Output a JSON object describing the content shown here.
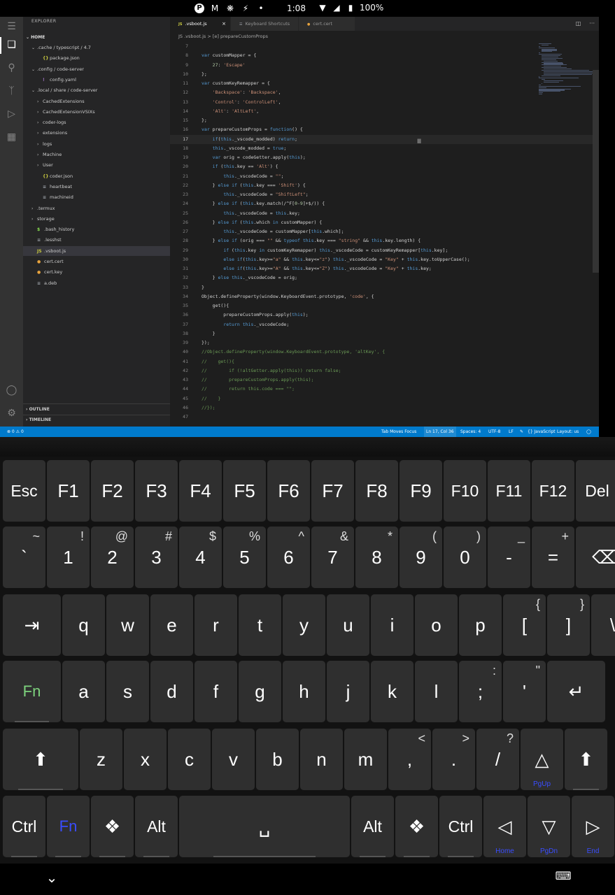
{
  "status_bar": {
    "time": "1:08",
    "battery_text": "100%"
  },
  "vscode": {
    "sidebar": {
      "title": "EXPLORER",
      "section": "HOME",
      "items": [
        {
          "label": ".cache / typescript / 4.7",
          "indent": 1,
          "chev": "⌄",
          "icon": ""
        },
        {
          "label": "package.json",
          "indent": 2,
          "chev": "",
          "icon": "{}"
        },
        {
          "label": ".config / code-server",
          "indent": 1,
          "chev": "⌄",
          "icon": ""
        },
        {
          "label": "config.yaml",
          "indent": 2,
          "chev": "",
          "icon": "!"
        },
        {
          "label": ".local / share / code-server",
          "indent": 1,
          "chev": "⌄",
          "icon": ""
        },
        {
          "label": "CachedExtensions",
          "indent": 2,
          "chev": "›",
          "icon": ""
        },
        {
          "label": "CachedExtensionVSIXs",
          "indent": 2,
          "chev": "›",
          "icon": ""
        },
        {
          "label": "coder-logs",
          "indent": 2,
          "chev": "›",
          "icon": ""
        },
        {
          "label": "extensions",
          "indent": 2,
          "chev": "›",
          "icon": ""
        },
        {
          "label": "logs",
          "indent": 2,
          "chev": "›",
          "icon": ""
        },
        {
          "label": "Machine",
          "indent": 2,
          "chev": "›",
          "icon": ""
        },
        {
          "label": "User",
          "indent": 2,
          "chev": "›",
          "icon": ""
        },
        {
          "label": "coder.json",
          "indent": 2,
          "chev": "",
          "icon": "{}"
        },
        {
          "label": "heartbeat",
          "indent": 2,
          "chev": "",
          "icon": "≡"
        },
        {
          "label": "machineid",
          "indent": 2,
          "chev": "",
          "icon": "≡"
        },
        {
          "label": ".termux",
          "indent": 1,
          "chev": "›",
          "icon": ""
        },
        {
          "label": "storage",
          "indent": 1,
          "chev": "›",
          "icon": ""
        },
        {
          "label": ".bash_history",
          "indent": 1,
          "chev": "",
          "icon": "$"
        },
        {
          "label": ".lesshst",
          "indent": 1,
          "chev": "",
          "icon": "≡"
        },
        {
          "label": ".vsboot.js",
          "indent": 1,
          "chev": "",
          "icon": "JS"
        },
        {
          "label": "cert.cert",
          "indent": 1,
          "chev": "",
          "icon": "●"
        },
        {
          "label": "cert.key",
          "indent": 1,
          "chev": "",
          "icon": "●"
        },
        {
          "label": "a.deb",
          "indent": 1,
          "chev": "",
          "icon": "≡"
        }
      ],
      "outline": "OUTLINE",
      "timeline": "TIMELINE"
    },
    "tabs": [
      {
        "label": ".vsboot.js",
        "icon": "JS",
        "close": "×"
      },
      {
        "label": "Keyboard Shortcuts",
        "icon": "☰",
        "close": ""
      },
      {
        "label": "cert.cert",
        "icon": "●",
        "close": ""
      }
    ],
    "breadcrumbs": "JS  .vsboot.js  >  [e] prepareCustomProps",
    "code": [
      {
        "n": "7",
        "t": ""
      },
      {
        "n": "8",
        "t": "var customMapper = {"
      },
      {
        "n": "9",
        "t": "    27: 'Escape'"
      },
      {
        "n": "10",
        "t": "};"
      },
      {
        "n": "11",
        "t": "var customKeyRemapper = {"
      },
      {
        "n": "12",
        "t": "    'Backspace': 'Backspace',"
      },
      {
        "n": "13",
        "t": "    'Control': 'ControlLeft',"
      },
      {
        "n": "14",
        "t": "    'Alt': 'AltLeft',"
      },
      {
        "n": "15",
        "t": "};"
      },
      {
        "n": "16",
        "t": "var prepareCustomProps = function() {"
      },
      {
        "n": "17",
        "t": "    if(this._vscode_modded) return;"
      },
      {
        "n": "18",
        "t": "    this._vscode_modded = true;"
      },
      {
        "n": "19",
        "t": "    var orig = codeGetter.apply(this);"
      },
      {
        "n": "20",
        "t": "    if (this.key == 'Alt') {"
      },
      {
        "n": "21",
        "t": "        this._vscodeCode = \"\";"
      },
      {
        "n": "22",
        "t": "    } else if (this.key === 'Shift') {"
      },
      {
        "n": "23",
        "t": "        this._vscodeCode = \"ShiftLeft\";"
      },
      {
        "n": "24",
        "t": "    } else if (this.key.match(/^F[0-9]+$/)) {"
      },
      {
        "n": "25",
        "t": "        this._vscodeCode = this.key;"
      },
      {
        "n": "26",
        "t": "    } else if (this.which in customMapper) {"
      },
      {
        "n": "27",
        "t": "        this._vscodeCode = customMapper[this.which];"
      },
      {
        "n": "28",
        "t": "    } else if (orig === \"\" && typeof this.key === \"string\" && this.key.length) {"
      },
      {
        "n": "29",
        "t": "        if (this.key in customKeyRemapper) this._vscodeCode = customKeyRemapper[this.key];"
      },
      {
        "n": "30",
        "t": "        else if(this.key>=\"a\" && this.key<=\"z\") this._vscodeCode = \"Key\" + this.key.toUpperCase();"
      },
      {
        "n": "31",
        "t": "        else if(this.key>=\"A\" && this.key<=\"Z\") this._vscodeCode = \"Key\" + this.key;"
      },
      {
        "n": "32",
        "t": "    } else this._vscodeCode = orig;"
      },
      {
        "n": "33",
        "t": "}"
      },
      {
        "n": "34",
        "t": "Object.defineProperty(window.KeyboardEvent.prototype, 'code', {"
      },
      {
        "n": "35",
        "t": "    get(){"
      },
      {
        "n": "36",
        "t": "        prepareCustomProps.apply(this);"
      },
      {
        "n": "37",
        "t": "        return this._vscodeCode;"
      },
      {
        "n": "38",
        "t": "    }"
      },
      {
        "n": "39",
        "t": "});"
      },
      {
        "n": "40",
        "t": "//Object.defineProperty(window.KeyboardEvent.prototype, 'altKey', {"
      },
      {
        "n": "41",
        "t": "//    get(){"
      },
      {
        "n": "42",
        "t": "//        if (!altGetter.apply(this)) return false;"
      },
      {
        "n": "43",
        "t": "//        prepareCustomProps.apply(this);"
      },
      {
        "n": "44",
        "t": "//        return this.code === \"\";"
      },
      {
        "n": "45",
        "t": "//    }"
      },
      {
        "n": "46",
        "t": "//});"
      },
      {
        "n": "47",
        "t": ""
      }
    ],
    "statusbar": {
      "left": "⊗ 0  ⚠ 0",
      "tab_moves_focus": "Tab Moves Focus",
      "position": "Ln 17, Col 36",
      "spaces": "Spaces: 4",
      "encoding": "UTF-8",
      "eol": "LF",
      "language": "{} JavaScript",
      "layout": "Layout: us",
      "bell": "⌂"
    }
  },
  "keyboard": {
    "rows": [
      [
        {
          "main": "Esc",
          "w": 1
        },
        {
          "main": "F1",
          "w": 1
        },
        {
          "main": "F2",
          "w": 1
        },
        {
          "main": "F3",
          "w": 1
        },
        {
          "main": "F4",
          "w": 1
        },
        {
          "main": "F5",
          "w": 1
        },
        {
          "main": "F6",
          "w": 1
        },
        {
          "main": "F7",
          "w": 1
        },
        {
          "main": "F8",
          "w": 1
        },
        {
          "main": "F9",
          "w": 1
        },
        {
          "main": "F10",
          "w": 1
        },
        {
          "main": "F11",
          "w": 1
        },
        {
          "main": "F12",
          "w": 1
        },
        {
          "main": "Del",
          "w": 1
        }
      ],
      [
        {
          "main": "`",
          "sub": "~",
          "w": 1
        },
        {
          "main": "1",
          "sub": "!",
          "w": 1
        },
        {
          "main": "2",
          "sub": "@",
          "w": 1
        },
        {
          "main": "3",
          "sub": "#",
          "w": 1
        },
        {
          "main": "4",
          "sub": "$",
          "w": 1
        },
        {
          "main": "5",
          "sub": "%",
          "w": 1
        },
        {
          "main": "6",
          "sub": "^",
          "w": 1
        },
        {
          "main": "7",
          "sub": "&",
          "w": 1
        },
        {
          "main": "8",
          "sub": "*",
          "w": 1
        },
        {
          "main": "9",
          "sub": "(",
          "w": 1
        },
        {
          "main": "0",
          "sub": ")",
          "w": 1
        },
        {
          "main": "-",
          "sub": "_",
          "w": 1
        },
        {
          "main": "=",
          "sub": "+",
          "w": 1
        },
        {
          "main": "⌫",
          "w": 1.35
        }
      ],
      [
        {
          "main": "⇥",
          "w": 1.35
        },
        {
          "main": "q",
          "w": 1
        },
        {
          "main": "w",
          "w": 1
        },
        {
          "main": "e",
          "w": 1
        },
        {
          "main": "r",
          "w": 1
        },
        {
          "main": "t",
          "w": 1
        },
        {
          "main": "y",
          "w": 1
        },
        {
          "main": "u",
          "w": 1
        },
        {
          "main": "i",
          "w": 1
        },
        {
          "main": "o",
          "w": 1
        },
        {
          "main": "p",
          "w": 1
        },
        {
          "main": "[",
          "sub": "{",
          "w": 1
        },
        {
          "main": "]",
          "sub": "}",
          "w": 1
        },
        {
          "main": "\\",
          "sub": "|",
          "w": 1
        }
      ],
      [
        {
          "main": "Fn",
          "w": 1.35,
          "style": "green"
        },
        {
          "main": "a",
          "w": 1
        },
        {
          "main": "s",
          "w": 1
        },
        {
          "main": "d",
          "w": 1
        },
        {
          "main": "f",
          "w": 1
        },
        {
          "main": "g",
          "w": 1
        },
        {
          "main": "h",
          "w": 1
        },
        {
          "main": "j",
          "w": 1
        },
        {
          "main": "k",
          "w": 1
        },
        {
          "main": "l",
          "w": 1
        },
        {
          "main": ";",
          "sub": ":",
          "w": 1
        },
        {
          "main": "'",
          "sub": "\"",
          "w": 1
        },
        {
          "main": "↵",
          "w": 1.35
        }
      ],
      [
        {
          "main": "⬆",
          "w": 1.75
        },
        {
          "main": "z",
          "w": 1
        },
        {
          "main": "x",
          "w": 1
        },
        {
          "main": "c",
          "w": 1
        },
        {
          "main": "v",
          "w": 1
        },
        {
          "main": "b",
          "w": 1
        },
        {
          "main": "n",
          "w": 1
        },
        {
          "main": "m",
          "w": 1
        },
        {
          "main": ",",
          "sub": "<",
          "w": 1
        },
        {
          "main": ".",
          "sub": ">",
          "w": 1
        },
        {
          "main": "/",
          "sub": "?",
          "w": 1
        },
        {
          "main": "△",
          "bot": "PgUp",
          "w": 1
        },
        {
          "main": "⬆",
          "w": 1
        }
      ],
      [
        {
          "main": "Ctrl",
          "w": 1
        },
        {
          "main": "Fn",
          "w": 1,
          "style": "blue"
        },
        {
          "main": "❖",
          "w": 1
        },
        {
          "main": "Alt",
          "w": 1
        },
        {
          "main": "␣",
          "w": 3.9
        },
        {
          "main": "Alt",
          "w": 1
        },
        {
          "main": "❖",
          "w": 1
        },
        {
          "main": "Ctrl",
          "w": 1
        },
        {
          "main": "◁",
          "bot": "Home",
          "w": 1
        },
        {
          "main": "▽",
          "bot": "PgDn",
          "w": 1
        },
        {
          "main": "▷",
          "bot": "End",
          "w": 1
        }
      ]
    ]
  },
  "navbar": {
    "down": "⌄",
    "keyboard": "⌨"
  }
}
